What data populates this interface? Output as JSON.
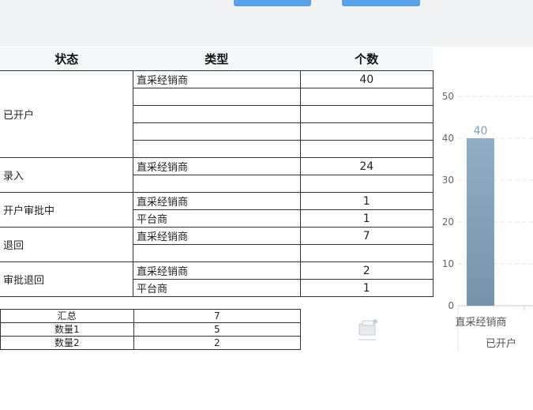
{
  "toolbar": {
    "left_button": "",
    "right_button": ""
  },
  "table": {
    "headers": [
      "状态",
      "类型",
      "个数"
    ],
    "groups": [
      {
        "status": "已开户",
        "rows": [
          {
            "type": "直采经销商",
            "count": "40"
          },
          {
            "type": "",
            "count": ""
          },
          {
            "type": "",
            "count": ""
          },
          {
            "type": "",
            "count": ""
          },
          {
            "type": "",
            "count": ""
          }
        ]
      },
      {
        "status": "录入",
        "rows": [
          {
            "type": "直采经销商",
            "count": "24"
          },
          {
            "type": "",
            "count": ""
          }
        ]
      },
      {
        "status": "开户审批中",
        "rows": [
          {
            "type": "直采经销商",
            "count": "1"
          },
          {
            "type": "平台商",
            "count": "1"
          }
        ]
      },
      {
        "status": "退回",
        "rows": [
          {
            "type": "直采经销商",
            "count": "7"
          },
          {
            "type": "",
            "count": ""
          }
        ]
      },
      {
        "status": "审批退回",
        "rows": [
          {
            "type": "直采经销商",
            "count": "2"
          },
          {
            "type": "平台商",
            "count": "1"
          }
        ]
      }
    ]
  },
  "summary": [
    {
      "label": "汇总",
      "value": "7"
    },
    {
      "label": "数量1",
      "value": "5"
    },
    {
      "label": "数量2",
      "value": "2"
    }
  ],
  "chart_data": {
    "type": "bar",
    "categories": [
      "直采经销商"
    ],
    "values": [
      40
    ],
    "x_group_label": "已开户",
    "ylim": [
      0,
      50
    ],
    "yticks": [
      0,
      10,
      20,
      30,
      40,
      50
    ],
    "grid": true,
    "bar_color": "#7f9fba",
    "label_color": "#7f9fba"
  }
}
